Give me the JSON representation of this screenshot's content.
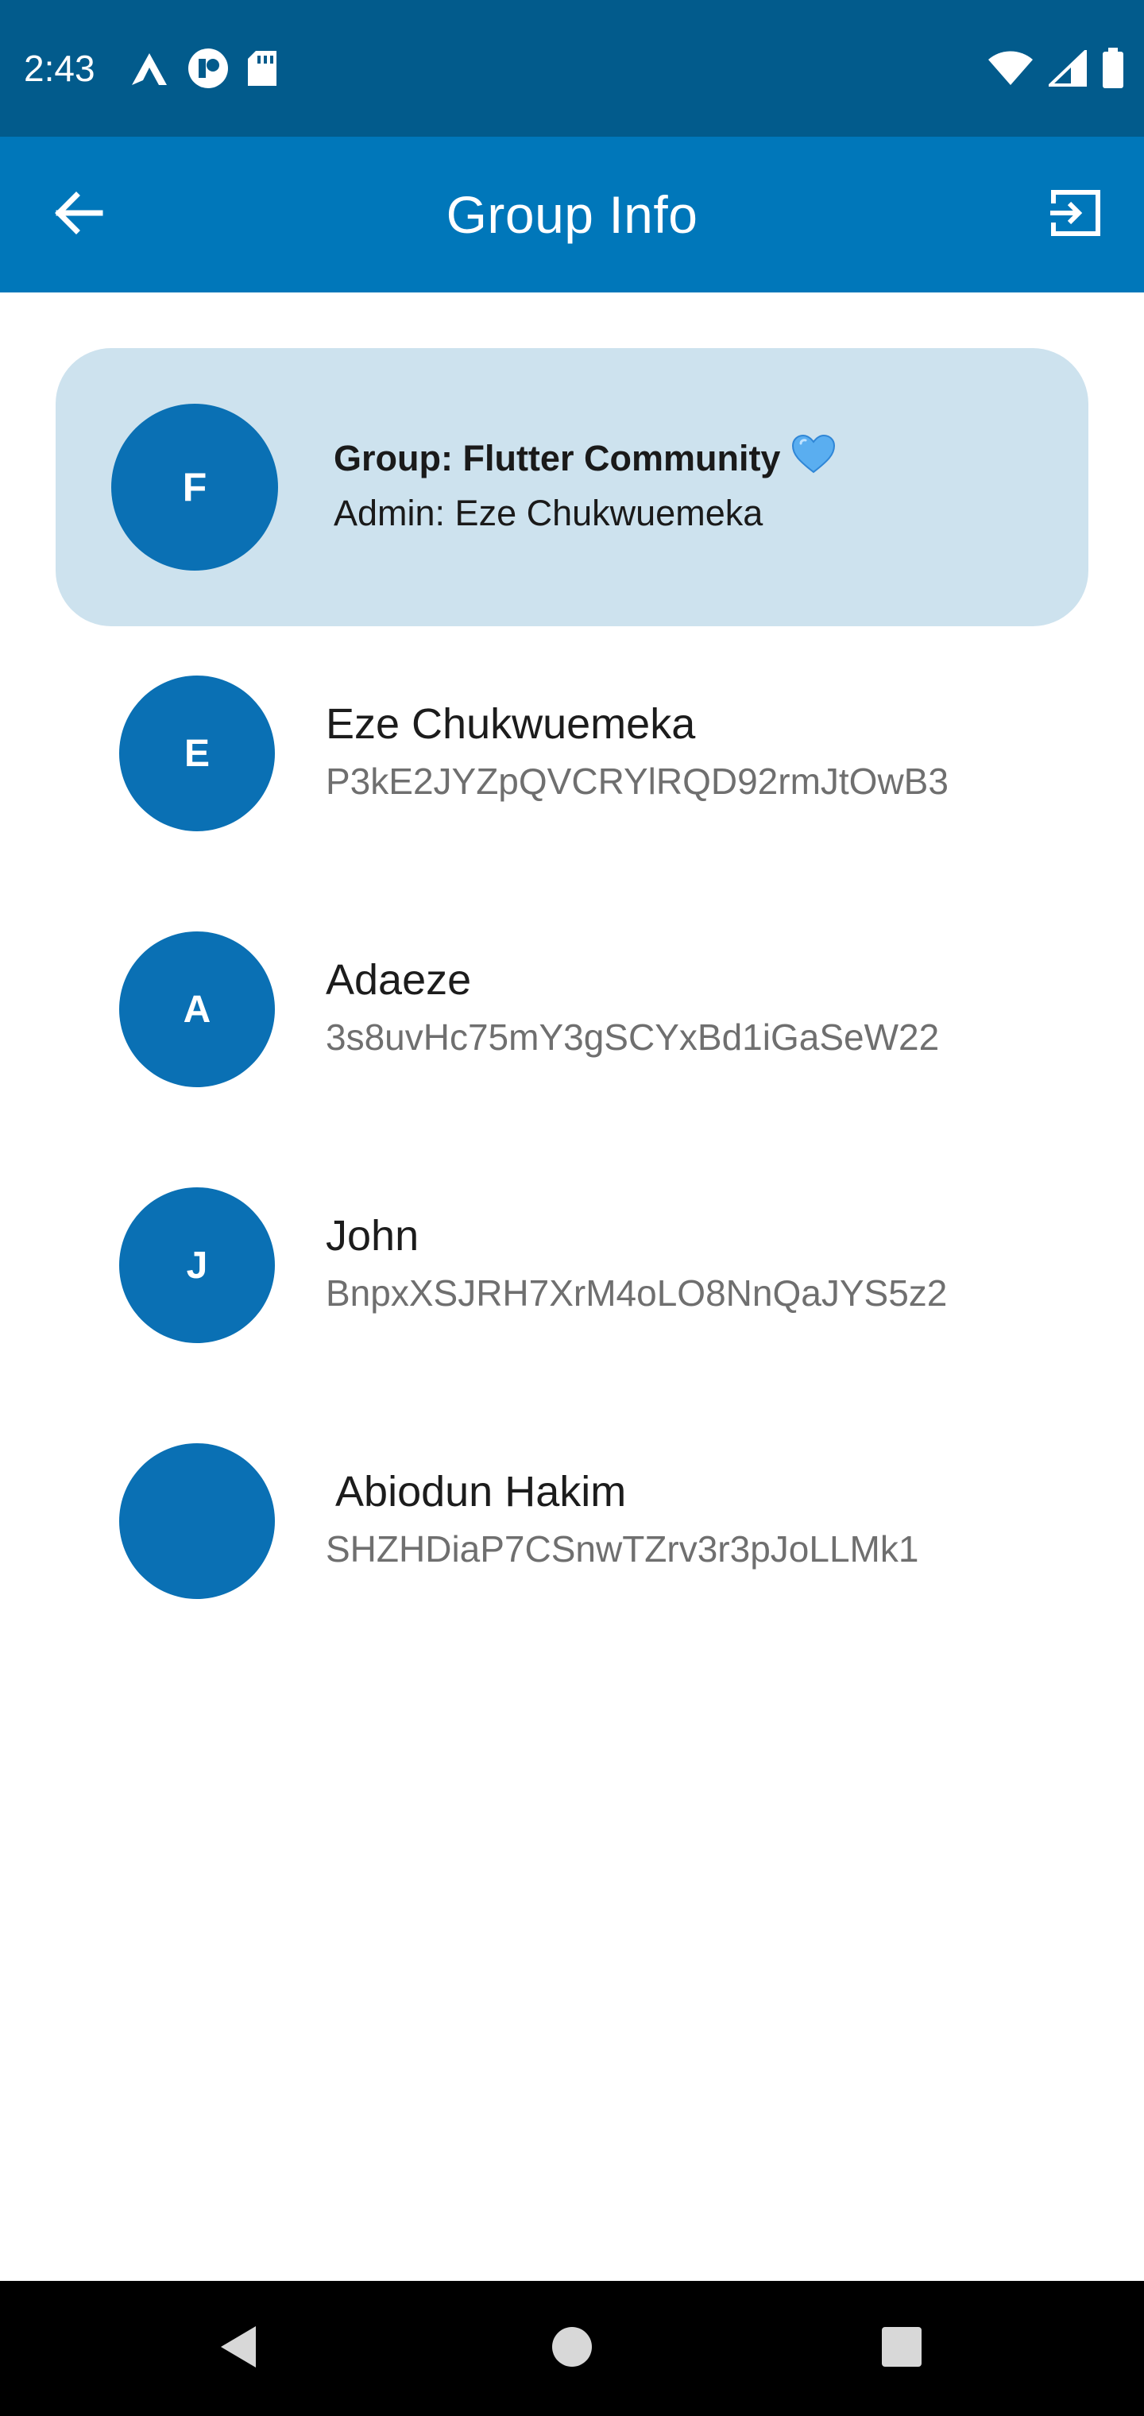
{
  "status_bar": {
    "time": "2:43",
    "left_icons": [
      "autodesk-icon",
      "notification-app-icon",
      "sd-card-icon"
    ],
    "right_icons": [
      "wifi-icon",
      "signal-icon",
      "battery-icon"
    ]
  },
  "app_bar": {
    "title": "Group Info",
    "back_icon": "arrow-left-icon",
    "exit_icon": "exit-group-icon"
  },
  "group": {
    "avatar_letter": "F",
    "name": "Group: Flutter Community",
    "emoji": "blue-heart-icon",
    "admin": "Admin: Eze Chukwuemeka"
  },
  "members": [
    {
      "initial": "E",
      "name": "Eze Chukwuemeka",
      "id": "P3kE2JYZpQVCRYlRQD92rmJtOwB3"
    },
    {
      "initial": "A",
      "name": "Adaeze",
      "id": "3s8uvHc75mY3gSCYxBd1iGaSeW22"
    },
    {
      "initial": "J",
      "name": "John",
      "id": "BnpxXSJRH7XrM4oLO8NnQaJYS5z2"
    },
    {
      "initial": "",
      "name": " Abiodun Hakim",
      "id": "SHZHDiaP7CSnwTZrv3r3pJoLLMk1"
    }
  ],
  "nav_bar": {
    "buttons": [
      "back-triangle-icon",
      "home-circle-icon",
      "recents-square-icon"
    ]
  },
  "colors": {
    "status_bar": "#025b8c",
    "app_bar": "#0077ba",
    "card_bg": "#cde2ee",
    "avatar": "#0a70b4",
    "nav_bar": "#000000"
  }
}
